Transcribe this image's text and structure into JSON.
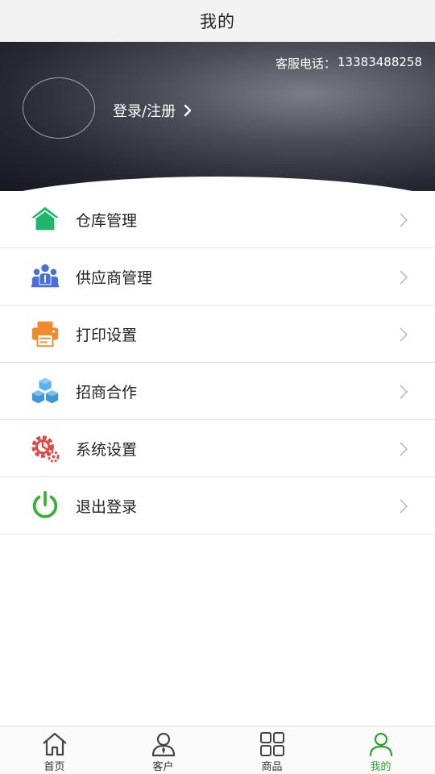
{
  "header": {
    "title": "我的"
  },
  "profile": {
    "service_label": "客服电话：",
    "service_phone": "13383488258",
    "login_label": "登录/注册"
  },
  "menu": [
    {
      "label": "仓库管理",
      "icon": "warehouse-icon",
      "color": "#1fb56a"
    },
    {
      "label": "供应商管理",
      "icon": "supplier-group-icon",
      "color": "#4a6fd8"
    },
    {
      "label": "打印设置",
      "icon": "printer-icon",
      "color": "#f08a2c"
    },
    {
      "label": "招商合作",
      "icon": "cubes-icon",
      "color": "#4aa3e6"
    },
    {
      "label": "系统设置",
      "icon": "gear-icon",
      "color": "#e04848"
    },
    {
      "label": "退出登录",
      "icon": "power-icon",
      "color": "#3cae3c"
    }
  ],
  "tabbar": [
    {
      "label": "首页",
      "icon": "home-icon",
      "active": false
    },
    {
      "label": "客户",
      "icon": "customer-icon",
      "active": false
    },
    {
      "label": "商品",
      "icon": "grid-icon",
      "active": false
    },
    {
      "label": "我的",
      "icon": "user-icon",
      "active": true
    }
  ],
  "colors": {
    "accent": "#2aa532",
    "title_bg": "#f2f2f2"
  }
}
